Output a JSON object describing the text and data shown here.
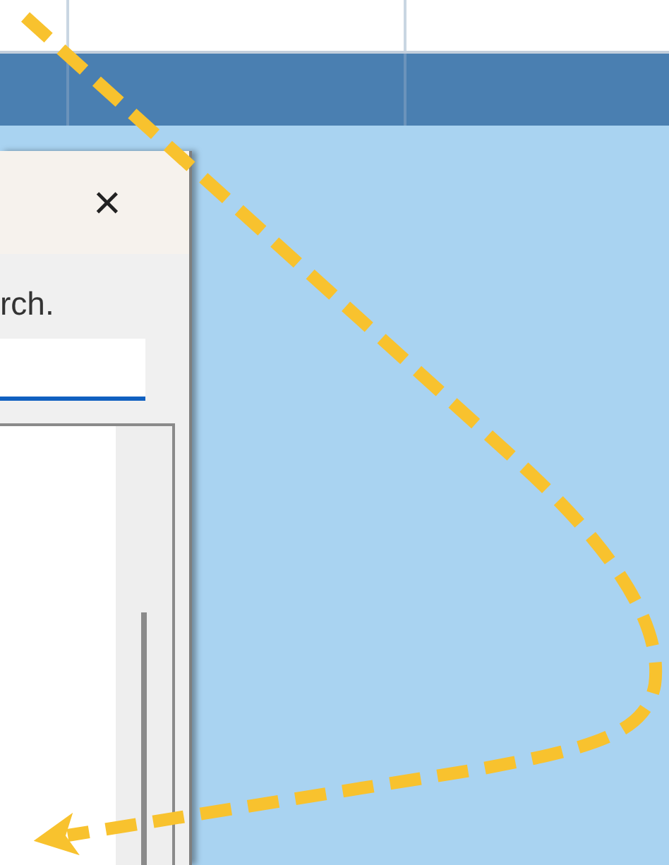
{
  "dialog": {
    "close_label": "×",
    "instruction": "rch.",
    "search_field": {
      "focused": true
    }
  }
}
